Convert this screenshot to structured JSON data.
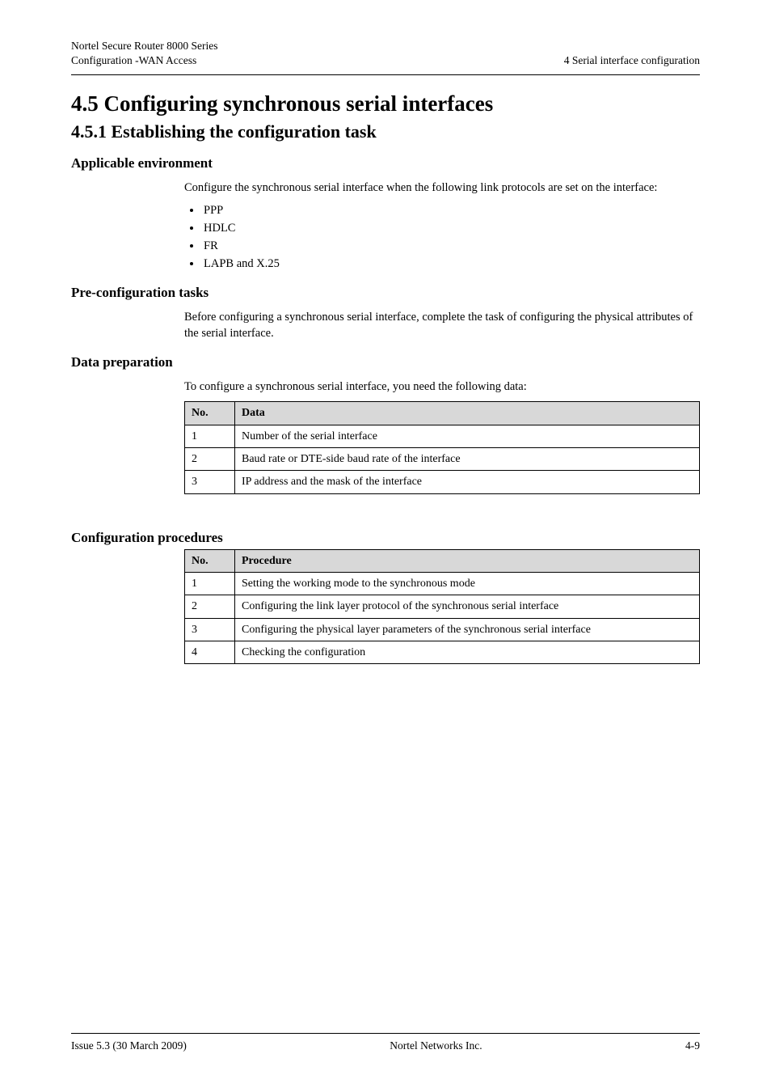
{
  "header": {
    "left_line1": "Nortel Secure Router 8000 Series",
    "left_line2": "Configuration -WAN Access",
    "right_line2": "4 Serial interface configuration"
  },
  "h1": "4.5 Configuring synchronous serial interfaces",
  "h2": "4.5.1 Establishing the configuration task",
  "sec_env": {
    "title": "Applicable environment",
    "intro": "Configure the synchronous serial interface when the following link protocols are set on the interface:",
    "bullets": [
      "PPP",
      "HDLC",
      "FR",
      "LAPB and X.25"
    ]
  },
  "sec_pre": {
    "title": "Pre-configuration tasks",
    "para": "Before configuring a synchronous serial interface, complete the task of configuring the physical attributes of the serial interface."
  },
  "sec_data": {
    "title": "Data preparation",
    "intro": "To configure a synchronous serial interface, you need the following data:",
    "table_headers": {
      "no": "No.",
      "item": "Data"
    },
    "rows": [
      {
        "no": "1",
        "item": "Number of the serial interface"
      },
      {
        "no": "2",
        "item": "Baud rate or DTE-side baud rate of the interface"
      },
      {
        "no": "3",
        "item": "IP address and the mask of the interface"
      }
    ]
  },
  "sec_proc": {
    "title": "Configuration procedures",
    "table_headers": {
      "no": "No.",
      "item": "Procedure"
    },
    "rows": [
      {
        "no": "1",
        "item": "Setting the working mode to the synchronous mode"
      },
      {
        "no": "2",
        "item": "Configuring the link layer protocol of the synchronous serial interface"
      },
      {
        "no": "3",
        "item": "Configuring the physical layer parameters of the synchronous serial interface"
      },
      {
        "no": "4",
        "item": "Checking the configuration"
      }
    ]
  },
  "footer": {
    "left_line1": "Issue 5.3 (30 March 2009)",
    "center_line1": "Nortel Networks Inc.",
    "right_line1": "4-9"
  }
}
